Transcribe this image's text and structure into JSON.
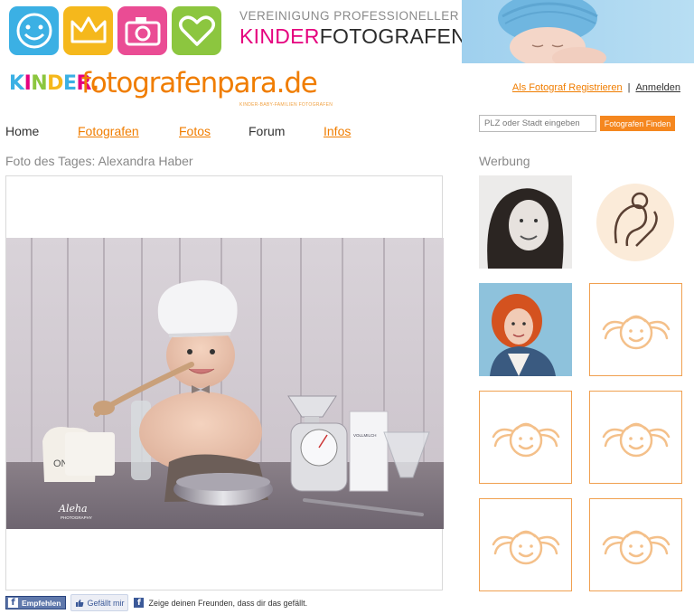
{
  "banner": {
    "association_line1": "VEREINIGUNG PROFESSIONELLER",
    "association_kinder": "KINDER",
    "association_fotografen": "FOTOGRAFEN"
  },
  "logo": {
    "kinder": "KINDER.",
    "main": "fotografenpara",
    "tld": ".de",
    "tagline": "KINDER-BABY-FAMILIEN FOTOGRAFEN"
  },
  "auth": {
    "register": "Als Fotograf Registrieren",
    "separator": "|",
    "login": "Anmelden"
  },
  "nav": {
    "items": [
      {
        "label": "Home"
      },
      {
        "label": "Fotografen"
      },
      {
        "label": "Fotos"
      },
      {
        "label": "Forum"
      },
      {
        "label": "Infos"
      }
    ]
  },
  "search": {
    "placeholder": "PLZ oder Stadt eingeben",
    "button": "Fotografen Finden"
  },
  "photo": {
    "title": "Foto des Tages: Alexandra Haber",
    "watermark_name": "Aleha",
    "watermark_sub": "PHOTOGRAPHY",
    "label_milk": "VOLLMILCH",
    "label_flour": "ONS"
  },
  "ads": {
    "title": "Werbung"
  },
  "social": {
    "share": "Empfehlen",
    "like": "Gefällt mir",
    "text": "Zeige deinen Freunden, dass dir das gefällt."
  },
  "colors": {
    "accent": "#f07d00",
    "placeholder_frame": "#f0a050",
    "facebook": "#3b5998"
  }
}
